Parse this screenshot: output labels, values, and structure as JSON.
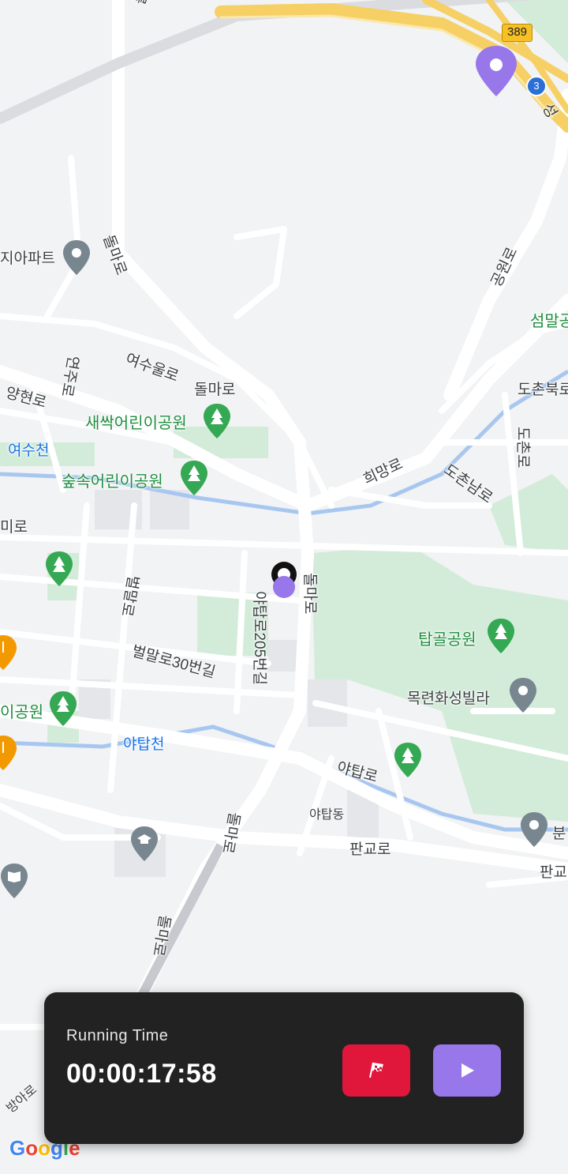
{
  "map": {
    "labels": {
      "dolmaro_top": "돌마로",
      "dolmaro_1": "돌마로",
      "dolmaro_2": "돌마로",
      "dolmaro_3": "돌마로",
      "dolmaro_4": "돌마로",
      "dolmaro_5": "돌마로",
      "apartment": "지아파트",
      "yeosuulro": "여수울로",
      "yanghyeonro": "양현로",
      "yeonjuro": "연주로",
      "saessak_park": "새싹어린이공원",
      "yeosucheon": "여수천",
      "supsok_park": "숲속어린이공원",
      "miro": "미로",
      "huimangro": "희망로",
      "dochonnamro": "도촌남로",
      "dochonbukro": "도촌북로",
      "dochonro": "도촌로",
      "seommal": "섬말공",
      "gongwonro": "공원로",
      "byeolmalro": "벌말로",
      "byeolmalro30": "벌말로30번길",
      "yatapro205": "야탑로205번길",
      "tapgol_park": "탑골공원",
      "mokryeon_villa": "목련화성빌라",
      "i_park": "이공원",
      "yatapcheon": "야탑천",
      "yatapro": "야탑로",
      "yatapdong": "야탑동",
      "pangyoro": "판교로",
      "pangyoro_right": "판교",
      "bun": "분",
      "seong": "성",
      "baearo": "방아로"
    },
    "shields": {
      "route389": "389",
      "route3": "3"
    },
    "attribution": "Google"
  },
  "timer_panel": {
    "label": "Running Time",
    "time": "00:00:17:58"
  },
  "colors": {
    "panel_bg": "#222223",
    "finish_button": "#e0163a",
    "play_button": "#9777ea",
    "location_dot": "#9777ea",
    "park_green": "#cdeed6",
    "highway_yellow": "#f6cf65",
    "water_blue": "#9fc5ef"
  },
  "icons": {
    "finish": "checkered-flag-icon",
    "play": "play-icon",
    "destination": "destination-pin-icon",
    "current": "current-location-icon"
  }
}
